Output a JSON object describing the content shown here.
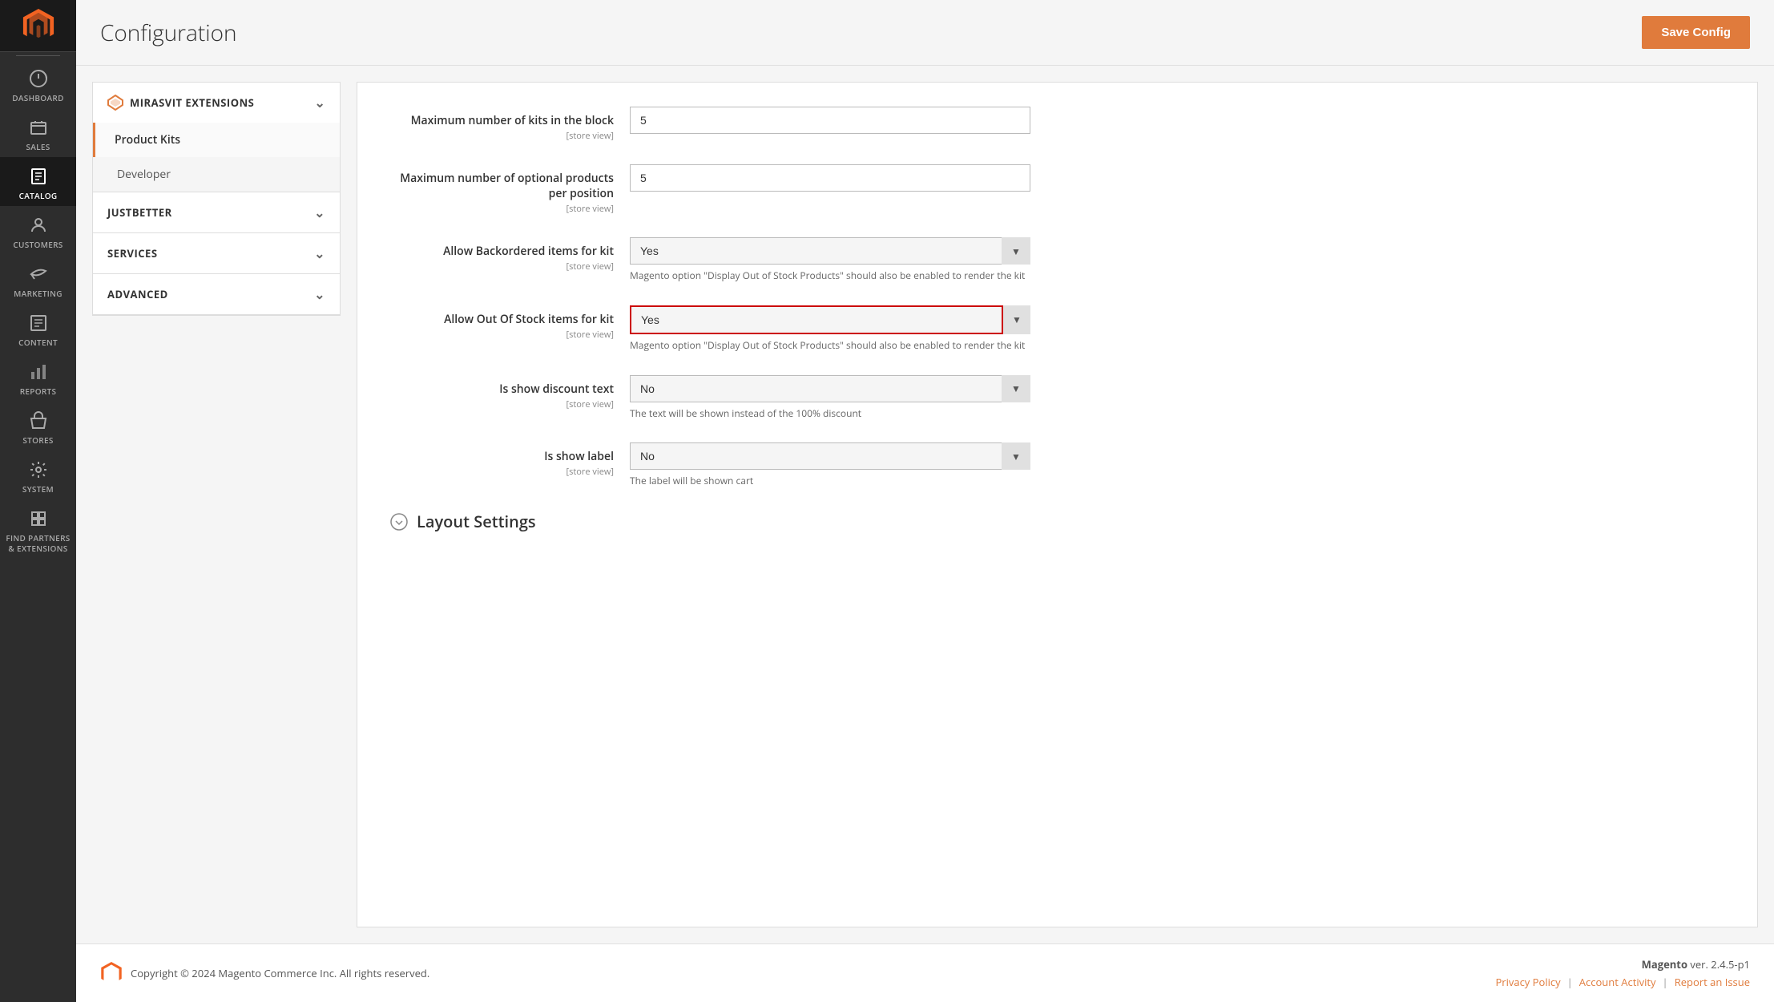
{
  "page": {
    "title": "Configuration",
    "save_button": "Save Config"
  },
  "sidebar": {
    "items": [
      {
        "id": "dashboard",
        "label": "DASHBOARD",
        "icon": "dashboard"
      },
      {
        "id": "sales",
        "label": "SALES",
        "icon": "sales"
      },
      {
        "id": "catalog",
        "label": "CATALOG",
        "icon": "catalog"
      },
      {
        "id": "customers",
        "label": "CUSTOMERS",
        "icon": "customers"
      },
      {
        "id": "marketing",
        "label": "MARKETING",
        "icon": "marketing"
      },
      {
        "id": "content",
        "label": "CONTENT",
        "icon": "content"
      },
      {
        "id": "reports",
        "label": "REPORTS",
        "icon": "reports"
      },
      {
        "id": "stores",
        "label": "STORES",
        "icon": "stores"
      },
      {
        "id": "system",
        "label": "SYSTEM",
        "icon": "system"
      },
      {
        "id": "find-partners",
        "label": "FIND PARTNERS & EXTENSIONS",
        "icon": "extensions"
      }
    ]
  },
  "left_nav": {
    "sections": [
      {
        "id": "mirasvit",
        "label": "MIRASVIT EXTENSIONS",
        "expanded": true,
        "items": [
          {
            "id": "product-kits",
            "label": "Product Kits",
            "active": true
          },
          {
            "id": "developer",
            "label": "Developer",
            "active": false
          }
        ]
      },
      {
        "id": "justbetter",
        "label": "JUSTBETTER",
        "expanded": false,
        "items": []
      },
      {
        "id": "services",
        "label": "SERVICES",
        "expanded": false,
        "items": []
      },
      {
        "id": "advanced",
        "label": "ADVANCED",
        "expanded": false,
        "items": []
      }
    ]
  },
  "form": {
    "fields": [
      {
        "id": "max-kits-block",
        "label": "Maximum number of kits in the block",
        "store_view": "[store view]",
        "type": "input",
        "value": "5"
      },
      {
        "id": "max-optional-products",
        "label": "Maximum number of optional products per position",
        "store_view": "[store view]",
        "type": "input",
        "value": "5"
      },
      {
        "id": "allow-backordered",
        "label": "Allow Backordered items for kit",
        "store_view": "[store view]",
        "type": "select",
        "value": "Yes",
        "highlighted": false,
        "hint": "Magento option \"Display Out of Stock Products\" should also be enabled to render the kit"
      },
      {
        "id": "allow-out-of-stock",
        "label": "Allow Out Of Stock items for kit",
        "store_view": "[store view]",
        "type": "select",
        "value": "Yes",
        "highlighted": true,
        "hint": "Magento option \"Display Out of Stock Products\" should also be enabled to render the kit"
      },
      {
        "id": "show-discount-text",
        "label": "Is show discount text",
        "store_view": "[store view]",
        "type": "select",
        "value": "No",
        "highlighted": false,
        "hint": "The text will be shown instead of the 100% discount"
      },
      {
        "id": "show-label",
        "label": "Is show label",
        "store_view": "[store view]",
        "type": "select",
        "value": "No",
        "highlighted": false,
        "hint": "The label will be shown cart"
      }
    ],
    "layout_section": "Layout Settings"
  },
  "footer": {
    "copyright": "Copyright © 2024 Magento Commerce Inc. All rights reserved.",
    "version_label": "Magento",
    "version": "ver. 2.4.5-p1",
    "links": [
      {
        "id": "privacy",
        "label": "Privacy Policy"
      },
      {
        "id": "activity",
        "label": "Account Activity"
      },
      {
        "id": "report",
        "label": "Report an Issue"
      }
    ]
  }
}
